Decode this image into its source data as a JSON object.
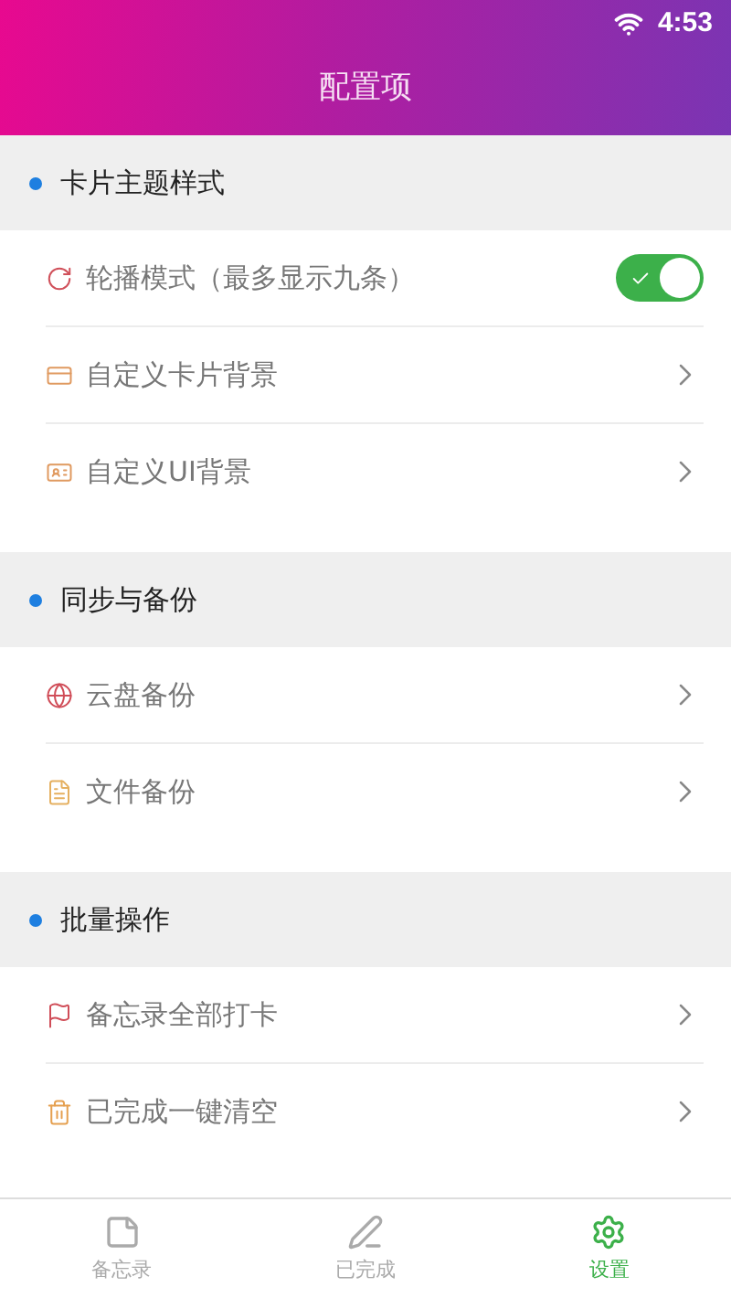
{
  "status_bar": {
    "time": "4:53"
  },
  "header": {
    "title": "配置项"
  },
  "sections": [
    {
      "title": "卡片主题样式",
      "items": [
        {
          "label": "轮播模式（最多显示九条）",
          "kind": "toggle",
          "on": true
        },
        {
          "label": "自定义卡片背景",
          "kind": "link"
        },
        {
          "label": "自定义UI背景",
          "kind": "link"
        }
      ]
    },
    {
      "title": "同步与备份",
      "items": [
        {
          "label": "云盘备份",
          "kind": "link"
        },
        {
          "label": "文件备份",
          "kind": "link"
        }
      ]
    },
    {
      "title": "批量操作",
      "items": [
        {
          "label": "备忘录全部打卡",
          "kind": "link"
        },
        {
          "label": "已完成一键清空",
          "kind": "link"
        }
      ]
    }
  ],
  "tabs": [
    {
      "label": "备忘录",
      "selected": false
    },
    {
      "label": "已完成",
      "selected": false
    },
    {
      "label": "设置",
      "selected": true
    }
  ]
}
